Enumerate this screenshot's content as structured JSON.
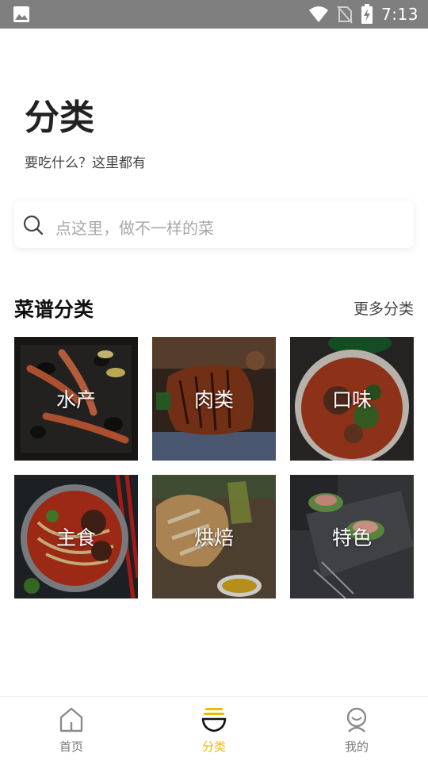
{
  "status_bar": {
    "time": "7:13"
  },
  "header": {
    "title": "分类",
    "subtitle": "要吃什么？这里都有"
  },
  "search": {
    "placeholder": "点这里，做不一样的菜"
  },
  "section": {
    "title": "菜谱分类",
    "more": "更多分类"
  },
  "categories": [
    {
      "label": "水产",
      "icon": "seafood-image"
    },
    {
      "label": "肉类",
      "icon": "meat-image"
    },
    {
      "label": "口味",
      "icon": "flavor-image"
    },
    {
      "label": "主食",
      "icon": "staple-image"
    },
    {
      "label": "烘焙",
      "icon": "bakery-image"
    },
    {
      "label": "特色",
      "icon": "specialty-image"
    }
  ],
  "bottom_nav": [
    {
      "label": "首页",
      "icon": "home-icon"
    },
    {
      "label": "分类",
      "icon": "bowl-icon",
      "active": true
    },
    {
      "label": "我的",
      "icon": "profile-icon"
    }
  ],
  "colors": {
    "accent": "#f2b900",
    "status_bar": "#7f7f7f"
  }
}
